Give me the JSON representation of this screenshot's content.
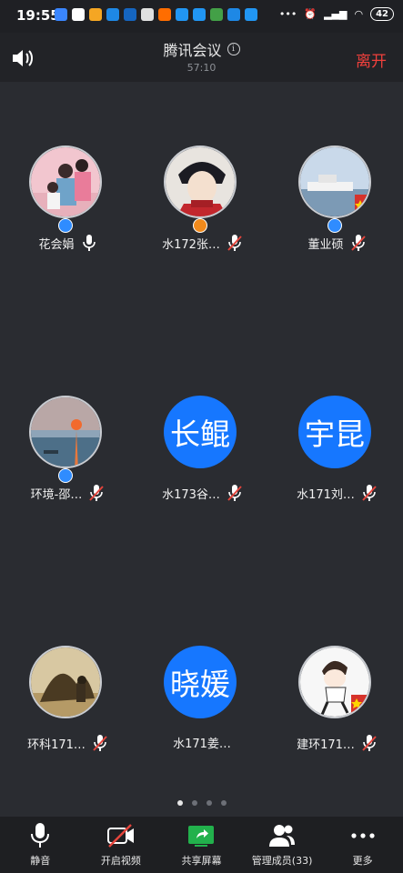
{
  "status_bar": {
    "time": "19:55",
    "battery": "42"
  },
  "header": {
    "title": "腾讯会议",
    "timer": "57:10",
    "leave_label": "离开"
  },
  "participants": [
    {
      "name": "花会娟",
      "avatar_type": "photo",
      "host_badge": "blue",
      "mic": "on"
    },
    {
      "name": "水172张…",
      "avatar_type": "photo",
      "host_badge": "orange",
      "mic": "muted"
    },
    {
      "name": "董业硕",
      "avatar_type": "photo",
      "host_badge": "blue",
      "mic": "muted"
    },
    {
      "name": "环境-邵…",
      "avatar_type": "photo",
      "host_badge": "blue",
      "mic": "muted"
    },
    {
      "name": "水173谷…",
      "avatar_type": "text",
      "avatar_text": "长鲲",
      "mic": "muted"
    },
    {
      "name": "水171刘…",
      "avatar_type": "text",
      "avatar_text": "宇昆",
      "mic": "muted"
    },
    {
      "name": "环科171…",
      "avatar_type": "photo",
      "mic": "muted"
    },
    {
      "name": "水171姜…",
      "avatar_type": "text",
      "avatar_text": "晓媛",
      "mic": "none"
    },
    {
      "name": "建环171…",
      "avatar_type": "photo",
      "mic": "muted"
    }
  ],
  "pagination": {
    "pages": 4,
    "active": 1
  },
  "toolbar": {
    "mute": "静音",
    "video": "开启视频",
    "share": "共享屏幕",
    "members": "管理成员(33)",
    "more": "更多"
  },
  "colors": {
    "accent_blue": "#1677ff",
    "leave_red": "#f0403c",
    "muted_red": "#e5453c",
    "share_green": "#22b14c"
  }
}
